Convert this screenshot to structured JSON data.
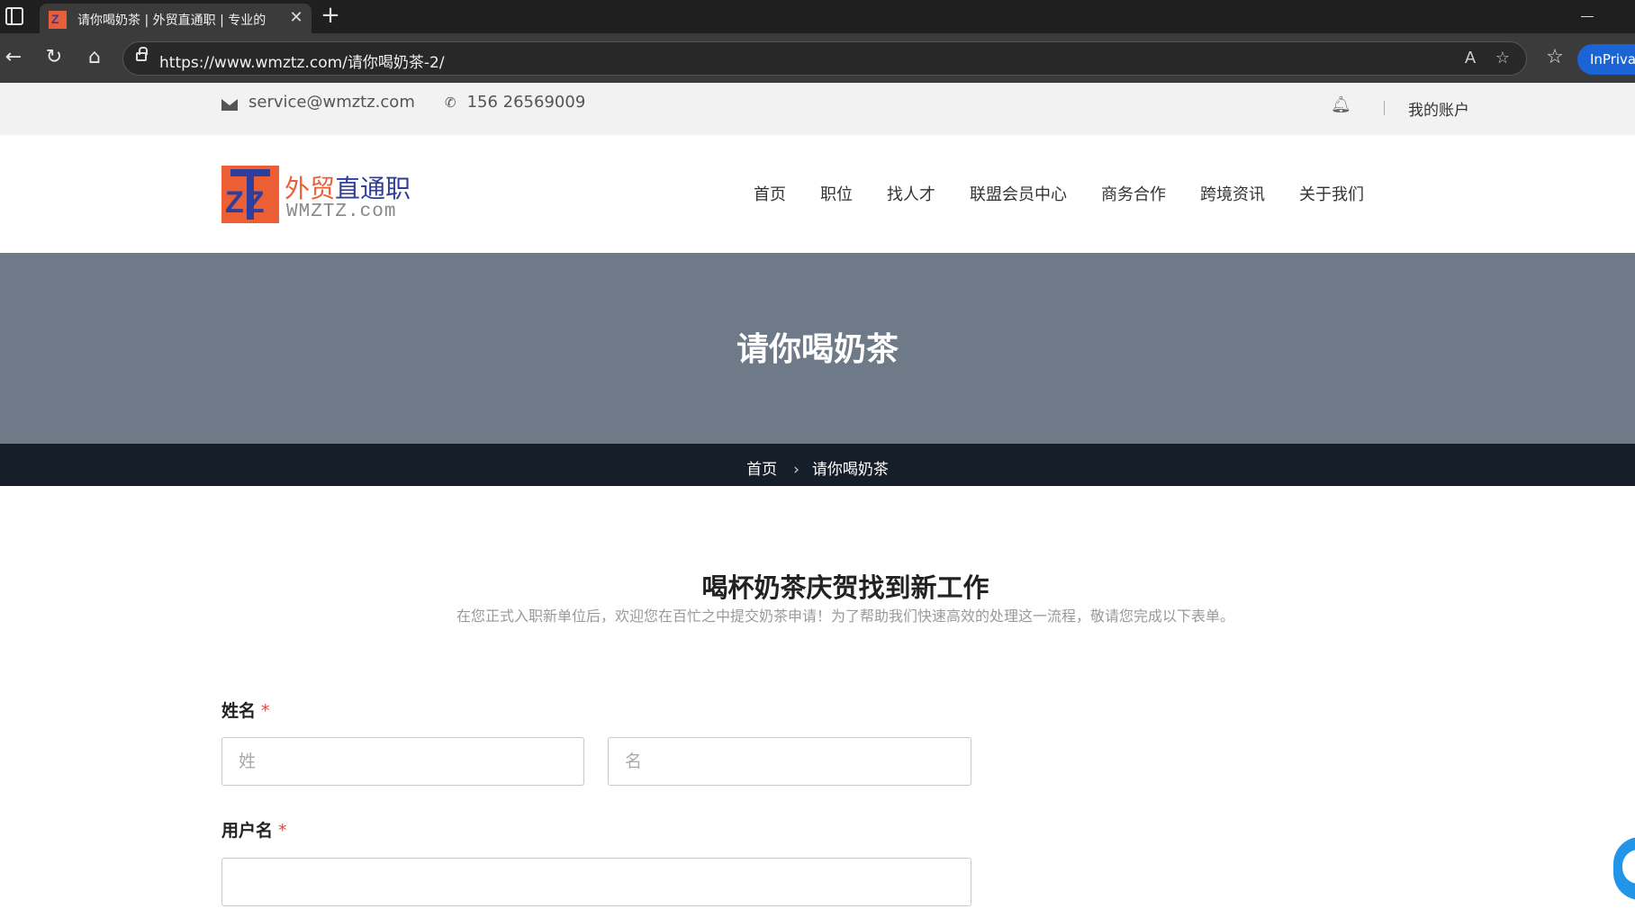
{
  "browser": {
    "tab_title": "请你喝奶茶 | 外贸直通职 | 专业的",
    "url": "https://www.wmztz.com/请你喝奶茶-2/",
    "inprivate_label": "InPrivate"
  },
  "topbar": {
    "email": "service@wmztz.com",
    "phone": "156 26569009",
    "account_label": "我的账户"
  },
  "logo": {
    "cn_part1": "外贸",
    "cn_part2": "直通职",
    "en": "WMZTZ.com"
  },
  "nav": {
    "items": [
      "首页",
      "职位",
      "找人才",
      "联盟会员中心",
      "商务合作",
      "跨境资讯",
      "关于我们"
    ]
  },
  "hero": {
    "title": "请你喝奶茶"
  },
  "breadcrumb": {
    "home": "首页",
    "separator": "›",
    "current": "请你喝奶茶"
  },
  "form": {
    "title": "喝杯奶茶庆贺找到新工作",
    "subtitle": "在您正式入职新单位后，欢迎您在百忙之中提交奶茶申请！为了帮助我们快速高效的处理这一流程，敬请您完成以下表单。",
    "name_label": "姓名",
    "required_mark": "*",
    "last_name_placeholder": "姓",
    "first_name_placeholder": "名",
    "username_label": "用户名",
    "username_value": ""
  },
  "colors": {
    "hero_bg": "#6f7a88",
    "breadcrumb_bg": "#161e2a",
    "brand_orange": "#ec5f35",
    "brand_blue": "#2e3e9d",
    "required": "#e0443c"
  }
}
